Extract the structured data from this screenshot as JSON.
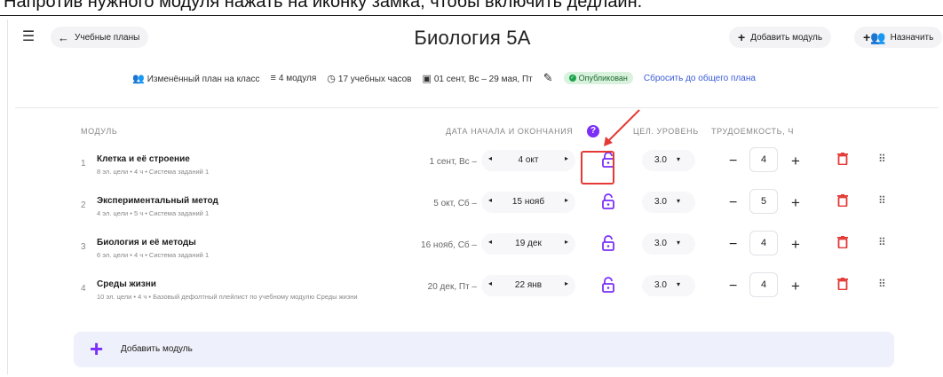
{
  "instruction": "Напротив нужного модуля нажать на иконку замка, чтобы включить дедлайн.",
  "header": {
    "menu_icon": "hamburger-icon",
    "back_label": "Учебные планы",
    "title": "Биология 5А",
    "add_module_label": "Добавить модуль",
    "assign_label": "Назначить"
  },
  "meta": {
    "plan_type": "Изменённый план на класс",
    "modules_count": "4 модуля",
    "hours": "17 учебных часов",
    "dates": "01 сент, Вс – 29 мая, Пт",
    "status": "Опубликован",
    "reset_link": "Сбросить до общего плана"
  },
  "columns": {
    "module": "МОДУЛЬ",
    "dates": "ДАТА НАЧАЛА И ОКОНЧАНИЯ",
    "level": "ЦЕЛ. УРОВЕНЬ",
    "effort": "ТРУДОЕМКОСТЬ, Ч"
  },
  "modules": [
    {
      "num": "1",
      "name": "Клетка и её строение",
      "sub": "8 эл. цели • 4 ч • Система заданий 1",
      "start": "1 сент, Вс –",
      "end": "4 окт",
      "level": "3.0",
      "hours": "4"
    },
    {
      "num": "2",
      "name": "Экспериментальный метод",
      "sub": "4 эл. цели • 5 ч • Система заданий 1",
      "start": "5 окт, Сб –",
      "end": "15 нояб",
      "level": "3.0",
      "hours": "5"
    },
    {
      "num": "3",
      "name": "Биология и её методы",
      "sub": "6 эл. цели • 4 ч • Система заданий 1",
      "start": "16 нояб, Сб –",
      "end": "19 дек",
      "level": "3.0",
      "hours": "4"
    },
    {
      "num": "4",
      "name": "Среды жизни",
      "sub": "10 эл. цели • 4 ч • Базовый дефолтный плейлист по учебному модулю Среды жизни",
      "start": "20 дек, Пт –",
      "end": "22 янв",
      "level": "3.0",
      "hours": "4"
    }
  ],
  "add_bar_label": "Добавить модуль",
  "colors": {
    "accent": "#7b2ff7",
    "highlight": "#e53935",
    "delete": "#e53935",
    "status_bg": "#d9f2de"
  }
}
